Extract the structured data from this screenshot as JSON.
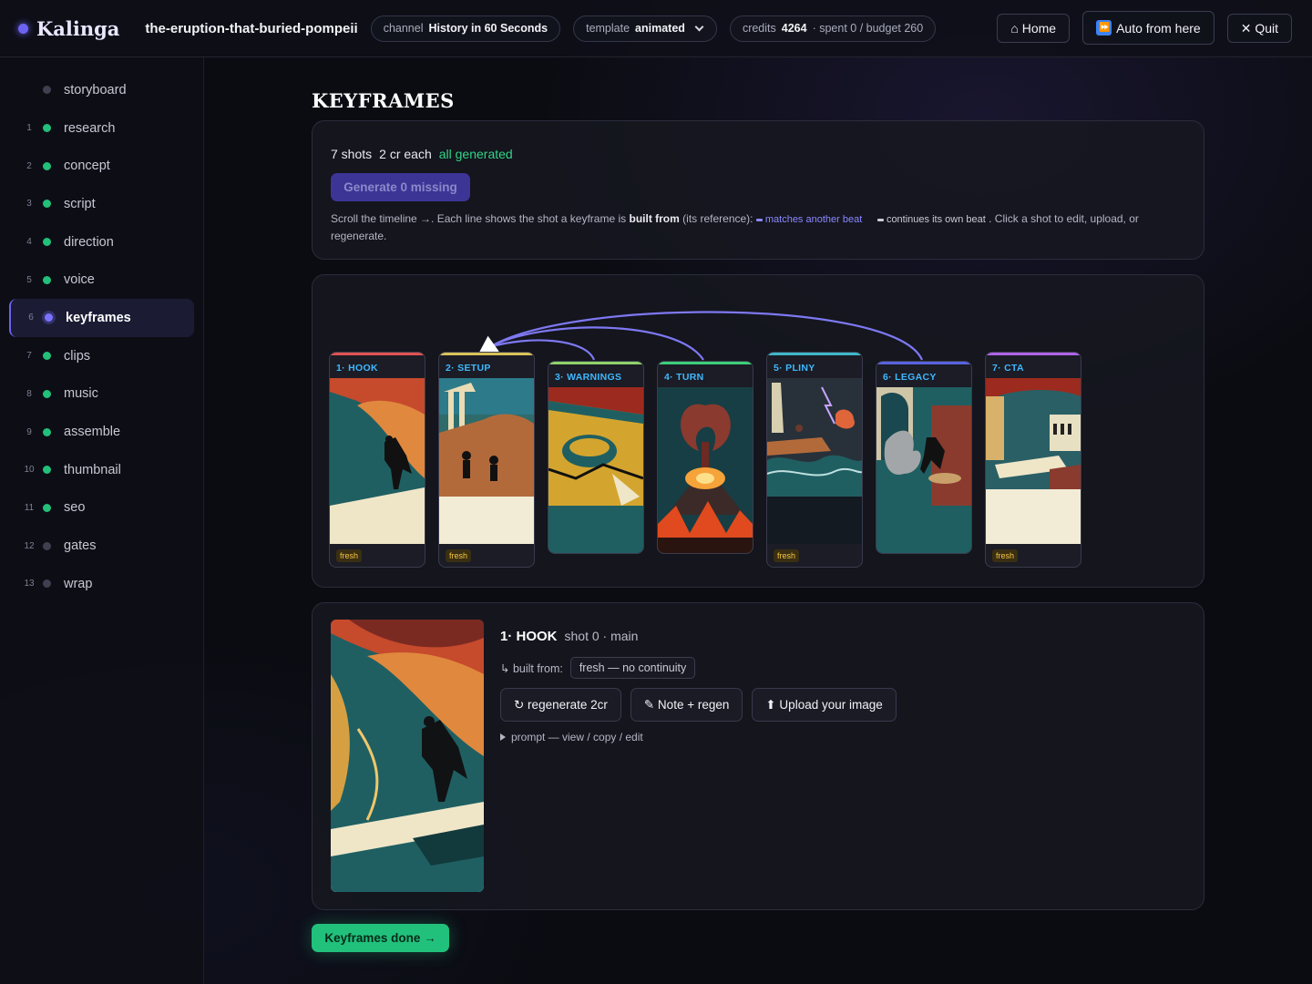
{
  "app": {
    "name": "Kalinga"
  },
  "header": {
    "project": "the-eruption-that-buried-pompeii",
    "channel_prefix": "channel",
    "channel_value": "History in 60 Seconds",
    "template_prefix": "template",
    "template_value": "animated",
    "credits_prefix": "credits",
    "credits_value": "4264",
    "credits_rest": "· spent 0 / budget 260",
    "home_label": "⌂ Home",
    "auto_label": "Auto from here",
    "auto_icon": "⏩",
    "quit_label": "✕ Quit"
  },
  "sidebar": {
    "items": [
      {
        "num": "",
        "label": "storyboard",
        "status": "gray",
        "icon": "diamond-icon"
      },
      {
        "num": "1",
        "label": "research",
        "status": "green"
      },
      {
        "num": "2",
        "label": "concept",
        "status": "green"
      },
      {
        "num": "3",
        "label": "script",
        "status": "green"
      },
      {
        "num": "4",
        "label": "direction",
        "status": "green"
      },
      {
        "num": "5",
        "label": "voice",
        "status": "green"
      },
      {
        "num": "6",
        "label": "keyframes",
        "status": "active"
      },
      {
        "num": "7",
        "label": "clips",
        "status": "green"
      },
      {
        "num": "8",
        "label": "music",
        "status": "green"
      },
      {
        "num": "9",
        "label": "assemble",
        "status": "green"
      },
      {
        "num": "10",
        "label": "thumbnail",
        "status": "green"
      },
      {
        "num": "11",
        "label": "seo",
        "status": "green"
      },
      {
        "num": "12",
        "label": "gates",
        "status": "gray"
      },
      {
        "num": "13",
        "label": "wrap",
        "status": "gray"
      }
    ]
  },
  "main": {
    "title": "KEYFRAMES",
    "summary": {
      "shots": "7 shots",
      "cost": "2 cr each",
      "state": "all generated",
      "generate_label": "Generate 0 missing",
      "hint_1": "Scroll the timeline →. Each line shows the shot a keyframe is",
      "hint_bold": "built from",
      "hint_2": "(its reference):",
      "legend_match": "matches another beat",
      "legend_continue": "continues its own beat",
      "hint_3": ". Click a shot to edit, upload, or regenerate."
    },
    "shots": [
      {
        "label": "1· HOOK",
        "color": "#e05252",
        "badge": "fresh",
        "tall": true
      },
      {
        "label": "2· SETUP",
        "color": "#d8c25a",
        "badge": "fresh",
        "tall": true
      },
      {
        "label": "3· WARNINGS",
        "color": "#8fd36a",
        "badge": "",
        "tall": false
      },
      {
        "label": "4· TURN",
        "color": "#3dcf7a",
        "badge": "",
        "tall": false
      },
      {
        "label": "5· PLINY",
        "color": "#3fb7c9",
        "badge": "fresh",
        "tall": true
      },
      {
        "label": "6· LEGACY",
        "color": "#5a63e0",
        "badge": "",
        "tall": false
      },
      {
        "label": "7· CTA",
        "color": "#b063e8",
        "badge": "fresh",
        "tall": true
      }
    ],
    "detail": {
      "title": "1· HOOK",
      "sub": "shot 0 · main",
      "built_label": "↳ built from:",
      "built_value": "fresh — no continuity",
      "regen_label": "↻ regenerate 2cr",
      "note_label": "✎ Note + regen",
      "upload_label": "⬆ Upload your image",
      "prompt_label": "prompt — view / copy / edit"
    },
    "done_label": "Keyframes done →"
  },
  "colors": {
    "accent": "#6d63f2",
    "success": "#21c17c",
    "link": "#8c87ff"
  }
}
